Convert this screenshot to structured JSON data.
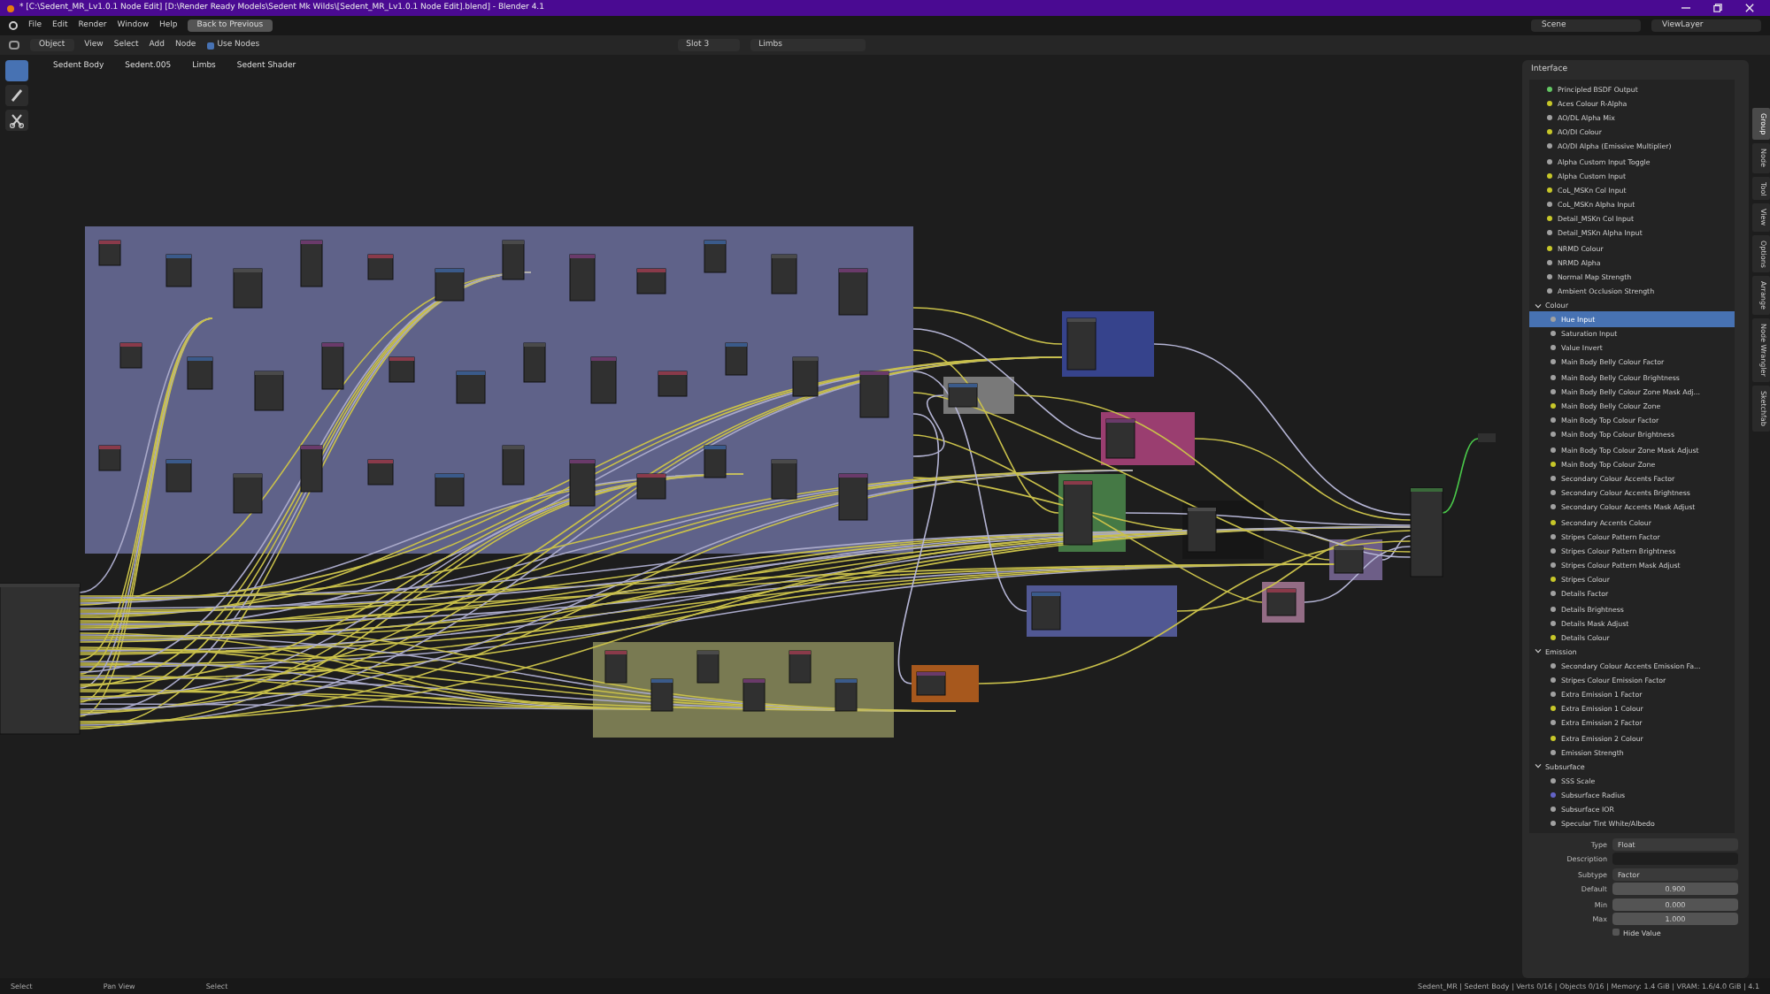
{
  "window": {
    "title": "* [C:\\Sedent_MR_Lv1.0.1 Node Edit] [D:\\Render Ready Models\\Sedent Mk Wilds\\[Sedent_MR_Lv1.0.1 Node Edit].blend] - Blender 4.1"
  },
  "menu": [
    "File",
    "Edit",
    "Render",
    "Window",
    "Help"
  ],
  "back_button": "Back to Previous",
  "scene": "Scene",
  "view_layer": "ViewLayer",
  "editor_header": {
    "mode": "Object",
    "menus": [
      "View",
      "Select",
      "Add",
      "Node"
    ],
    "use_nodes": {
      "label": "Use Nodes",
      "checked": true
    },
    "slot": "Slot 3",
    "material": "Limbs"
  },
  "breadcrumbs": [
    "Sedent Body",
    "Sedent.005",
    "Limbs",
    "Sedent Shader"
  ],
  "interface": {
    "title": "Interface",
    "items": [
      {
        "label": "Principled BSDF Output",
        "color": "#63c763",
        "selected": false
      },
      {
        "label": "Aces Colour R-Alpha",
        "color": "#c7c729",
        "selected": false
      },
      {
        "label": "AO/DL Alpha Mix",
        "color": "#a1a1a1",
        "selected": false
      },
      {
        "label": "AO/DI Colour",
        "color": "#c7c729",
        "selected": false
      },
      {
        "label": "AO/DI Alpha (Emissive Multiplier)",
        "color": "#a1a1a1",
        "selected": false
      },
      {
        "label": "Alpha Custom Input Toggle",
        "color": "#a1a1a1",
        "selected": false
      },
      {
        "label": "Alpha Custom Input",
        "color": "#c7c729",
        "selected": false
      },
      {
        "label": "CoL_MSKn Col Input",
        "color": "#c7c729",
        "selected": false
      },
      {
        "label": "CoL_MSKn Alpha Input",
        "color": "#a1a1a1",
        "selected": false
      },
      {
        "label": "Detail_MSKn Col Input",
        "color": "#c7c729",
        "selected": false
      },
      {
        "label": "Detail_MSKn Alpha Input",
        "color": "#a1a1a1",
        "selected": false
      },
      {
        "label": "NRMD Colour",
        "color": "#c7c729",
        "selected": false
      },
      {
        "label": "NRMD Alpha",
        "color": "#a1a1a1",
        "selected": false
      },
      {
        "label": "Normal Map Strength",
        "color": "#a1a1a1",
        "selected": false
      },
      {
        "label": "Ambient Occlusion Strength",
        "color": "#a1a1a1",
        "selected": false
      }
    ],
    "panels": [
      {
        "title": "Colour",
        "expanded": true,
        "items": [
          {
            "label": "Hue Input",
            "color": "#a1a1a1",
            "selected": true
          },
          {
            "label": "Saturation Input",
            "color": "#a1a1a1",
            "selected": false
          },
          {
            "label": "Value Invert",
            "color": "#a1a1a1",
            "selected": false
          },
          {
            "label": "Main Body Belly Colour Factor",
            "color": "#a1a1a1",
            "selected": false
          },
          {
            "label": "Main Body Belly Colour Brightness",
            "color": "#a1a1a1",
            "selected": false
          },
          {
            "label": "Main Body Belly Colour Zone Mask Adj...",
            "color": "#a1a1a1",
            "selected": false
          },
          {
            "label": "Main Body Belly Colour Zone",
            "color": "#c7c729",
            "selected": false
          },
          {
            "label": "Main Body Top Colour Factor",
            "color": "#a1a1a1",
            "selected": false
          },
          {
            "label": "Main Body Top Colour Brightness",
            "color": "#a1a1a1",
            "selected": false
          },
          {
            "label": "Main Body Top Colour Zone Mask Adjust",
            "color": "#a1a1a1",
            "selected": false
          },
          {
            "label": "Main Body Top Colour Zone",
            "color": "#c7c729",
            "selected": false
          },
          {
            "label": "Secondary Colour Accents Factor",
            "color": "#a1a1a1",
            "selected": false
          },
          {
            "label": "Secondary Colour Accents Brightness",
            "color": "#a1a1a1",
            "selected": false
          },
          {
            "label": "Secondary Colour Accents Mask Adjust",
            "color": "#a1a1a1",
            "selected": false
          },
          {
            "label": "Secondary Accents Colour",
            "color": "#c7c729",
            "selected": false
          },
          {
            "label": "Stripes Colour Pattern Factor",
            "color": "#a1a1a1",
            "selected": false
          },
          {
            "label": "Stripes Colour Pattern Brightness",
            "color": "#a1a1a1",
            "selected": false
          },
          {
            "label": "Stripes Colour Pattern Mask Adjust",
            "color": "#a1a1a1",
            "selected": false
          },
          {
            "label": "Stripes Colour",
            "color": "#c7c729",
            "selected": false
          },
          {
            "label": "Details Factor",
            "color": "#a1a1a1",
            "selected": false
          },
          {
            "label": "Details Brightness",
            "color": "#a1a1a1",
            "selected": false
          },
          {
            "label": "Details Mask Adjust",
            "color": "#a1a1a1",
            "selected": false
          },
          {
            "label": "Details Colour",
            "color": "#c7c729",
            "selected": false
          }
        ]
      },
      {
        "title": "Emission",
        "expanded": true,
        "items": [
          {
            "label": "Secondary Colour Accents Emission Fa...",
            "color": "#a1a1a1",
            "selected": false
          },
          {
            "label": "Stripes Colour Emission Factor",
            "color": "#a1a1a1",
            "selected": false
          },
          {
            "label": "Extra Emission 1 Factor",
            "color": "#a1a1a1",
            "selected": false
          },
          {
            "label": "Extra Emission 1 Colour",
            "color": "#c7c729",
            "selected": false
          },
          {
            "label": "Extra Emission 2 Factor",
            "color": "#a1a1a1",
            "selected": false
          },
          {
            "label": "Extra Emission 2 Colour",
            "color": "#c7c729",
            "selected": false
          },
          {
            "label": "Emission Strength",
            "color": "#a1a1a1",
            "selected": false
          }
        ]
      },
      {
        "title": "Subsurface",
        "expanded": true,
        "items": [
          {
            "label": "SSS Scale",
            "color": "#a1a1a1",
            "selected": false
          },
          {
            "label": "Subsurface Radius",
            "color": "#6363c7",
            "selected": false
          },
          {
            "label": "Subsurface IOR",
            "color": "#a1a1a1",
            "selected": false
          },
          {
            "label": "Specular Tint White/Albedo",
            "color": "#a1a1a1",
            "selected": false
          }
        ]
      }
    ]
  },
  "properties": {
    "type": {
      "label": "Type",
      "value": "Float"
    },
    "description": {
      "label": "Description"
    },
    "subtype": {
      "label": "Subtype",
      "value": "Factor"
    },
    "fields": [
      {
        "label": "Default",
        "value": "0.900"
      },
      {
        "label": "Min",
        "value": "0.000"
      },
      {
        "label": "Max",
        "value": "1.000"
      }
    ],
    "hide_value": {
      "label": "Hide Value",
      "checked": false
    }
  },
  "sidebar_tabs": [
    {
      "label": "Group",
      "selected": true
    },
    {
      "label": "Node",
      "selected": false
    },
    {
      "label": "Tool",
      "selected": false
    },
    {
      "label": "View",
      "selected": false
    },
    {
      "label": "Options",
      "selected": false
    },
    {
      "label": "Arrange",
      "selected": false
    },
    {
      "label": "Node Wrangler",
      "selected": false
    },
    {
      "label": "Sketchfab",
      "selected": false
    }
  ],
  "status_bar": {
    "hints": [
      "Select",
      "Pan View",
      "Select"
    ],
    "info": "Sedent_MR | Sedent Body | Verts 0/16 | Objects 0/16 | Memory: 1.4 GiB | VRAM: 1.6/4.0 GiB | 4.1"
  }
}
